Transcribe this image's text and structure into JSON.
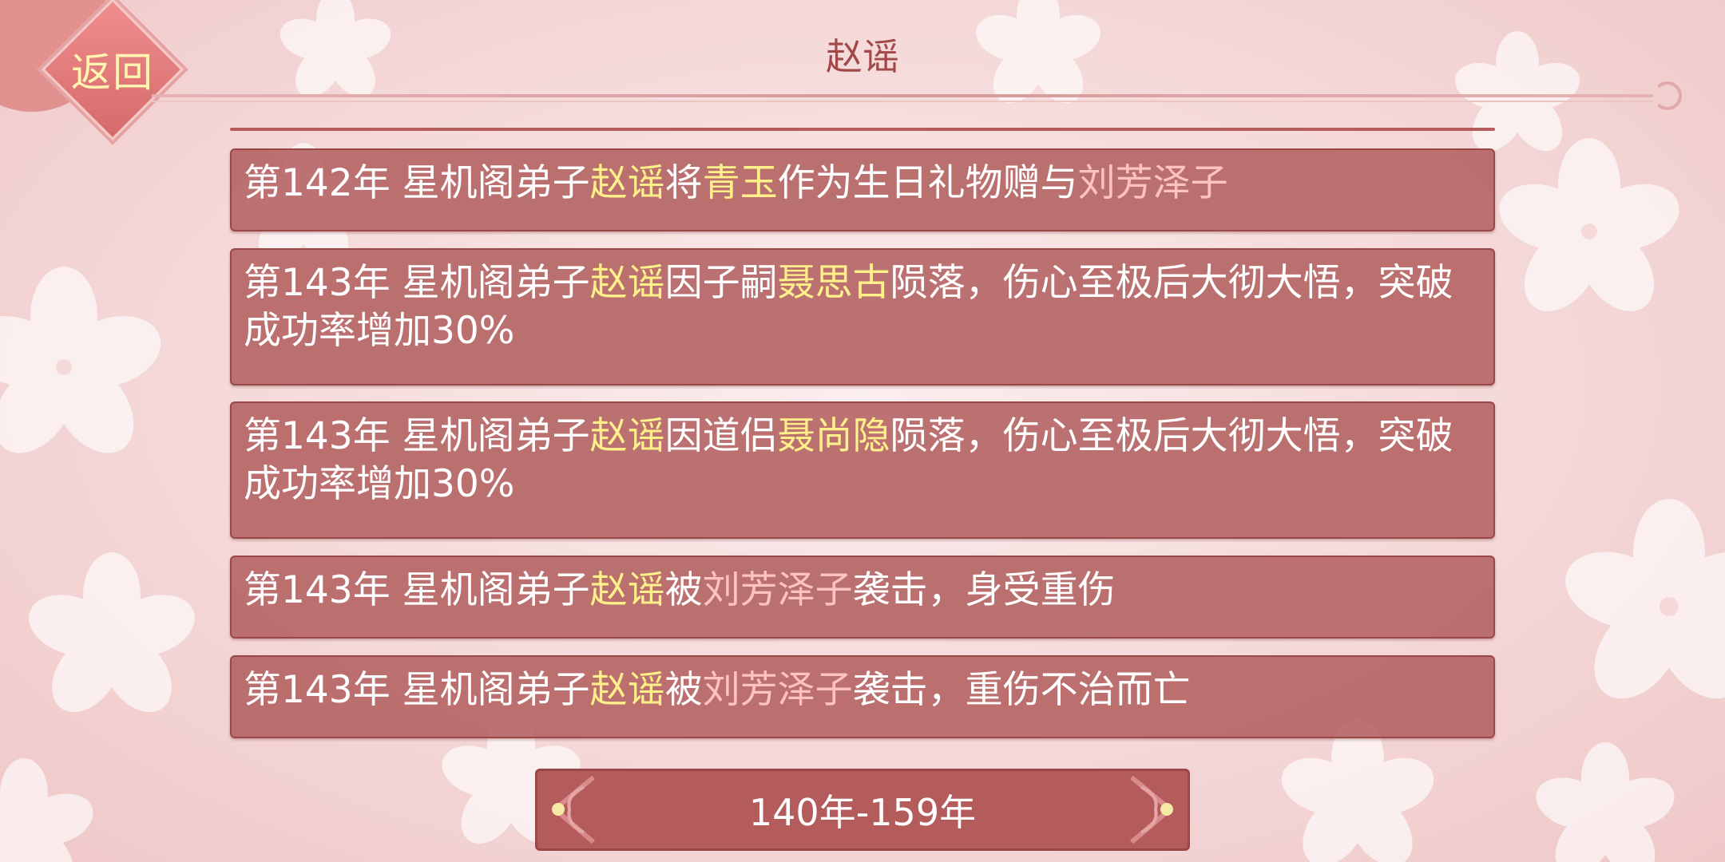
{
  "header": {
    "back_label": "返回",
    "title": "赵谣"
  },
  "colors": {
    "name_highlight": "#fff08a",
    "other_name": "#ffc2c2",
    "panel": "#b15d5d"
  },
  "events": [
    [
      {
        "text": "第142年 星机阁弟子",
        "style": "white"
      },
      {
        "text": "赵谣",
        "style": "yellow"
      },
      {
        "text": "将",
        "style": "white"
      },
      {
        "text": "青玉",
        "style": "yellow"
      },
      {
        "text": "作为生日礼物赠与",
        "style": "white"
      },
      {
        "text": "刘芳泽子",
        "style": "pink"
      }
    ],
    [
      {
        "text": "第143年 星机阁弟子",
        "style": "white"
      },
      {
        "text": "赵谣",
        "style": "yellow"
      },
      {
        "text": "因子嗣",
        "style": "white"
      },
      {
        "text": "聂思古",
        "style": "yellow"
      },
      {
        "text": "陨落，伤心至极后大彻大悟，突破成功率增加30%",
        "style": "white"
      }
    ],
    [
      {
        "text": "第143年 星机阁弟子",
        "style": "white"
      },
      {
        "text": "赵谣",
        "style": "yellow"
      },
      {
        "text": "因道侣",
        "style": "white"
      },
      {
        "text": "聂尚隐",
        "style": "yellow"
      },
      {
        "text": "陨落，伤心至极后大彻大悟，突破成功率增加30%",
        "style": "white"
      }
    ],
    [
      {
        "text": "第143年 星机阁弟子",
        "style": "white"
      },
      {
        "text": "赵谣",
        "style": "yellow"
      },
      {
        "text": "被",
        "style": "white"
      },
      {
        "text": "刘芳泽子",
        "style": "pink"
      },
      {
        "text": "袭击，身受重伤",
        "style": "white"
      }
    ],
    [
      {
        "text": "第143年 星机阁弟子",
        "style": "white"
      },
      {
        "text": "赵谣",
        "style": "yellow"
      },
      {
        "text": "被",
        "style": "white"
      },
      {
        "text": "刘芳泽子",
        "style": "pink"
      },
      {
        "text": "袭击，重伤不治而亡",
        "style": "white"
      }
    ]
  ],
  "pager": {
    "label": "140年-159年"
  }
}
